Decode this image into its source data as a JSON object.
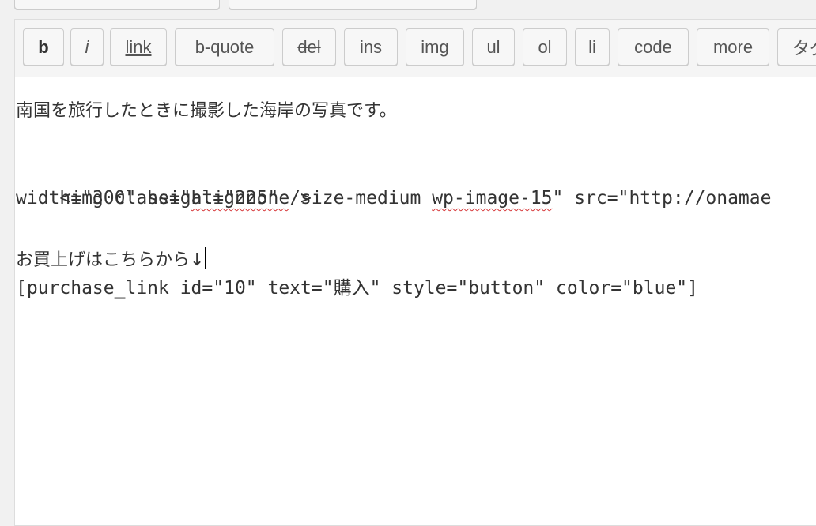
{
  "toolbar": {
    "buttons": [
      {
        "label": "b"
      },
      {
        "label": "i"
      },
      {
        "label": "link"
      },
      {
        "label": "b-quote"
      },
      {
        "label": "del"
      },
      {
        "label": "ins"
      },
      {
        "label": "img"
      },
      {
        "label": "ul"
      },
      {
        "label": "ol"
      },
      {
        "label": "li"
      },
      {
        "label": "code"
      },
      {
        "label": "more"
      },
      {
        "label": "タグ"
      }
    ]
  },
  "editor": {
    "line1": "南国を旅行したときに撮影した海岸の写真です。",
    "line2": {
      "part1": "<img class=\"",
      "part2": "alignnone",
      "part3": " size-medium ",
      "part4": "wp-image-15",
      "part5": "\" src=\"http://onamae"
    },
    "line3": "width=\"300\" height=\"225\" />",
    "line4": "お買上げはこちらから↓",
    "line5": "[purchase_link id=\"10\" text=\"購入\" style=\"button\" color=\"blue\"]"
  }
}
